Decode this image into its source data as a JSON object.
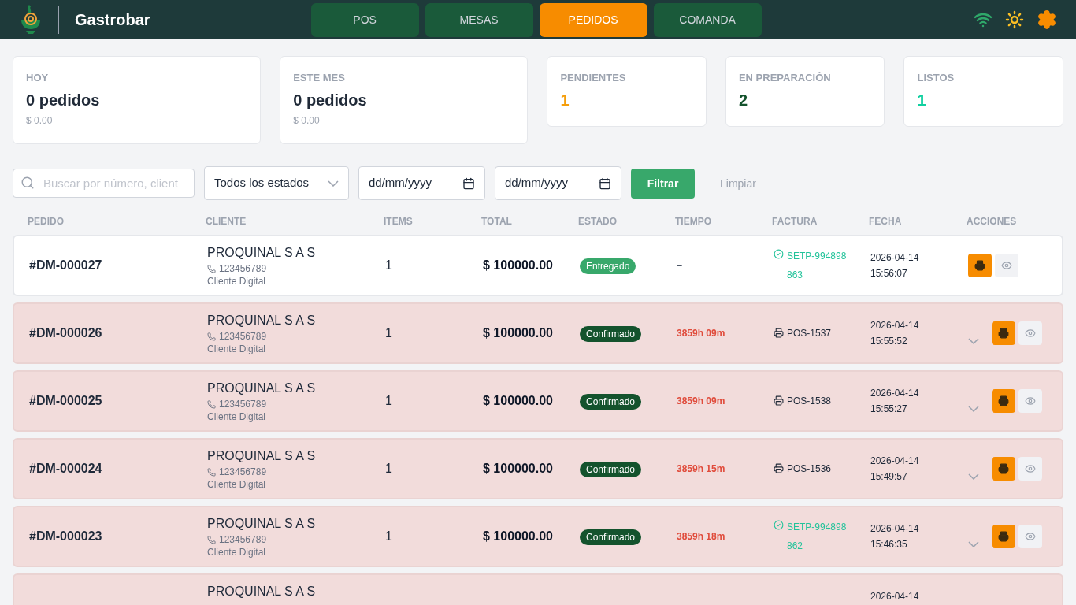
{
  "app": {
    "title": "Gastrobar"
  },
  "nav": [
    {
      "label": "POS",
      "selected": false
    },
    {
      "label": "MESAS",
      "selected": false
    },
    {
      "label": "PEDIDOS",
      "selected": true
    },
    {
      "label": "COMANDA",
      "selected": false
    }
  ],
  "stats": [
    {
      "label": "HOY",
      "value": "0 pedidos",
      "sub": "$ 0.00",
      "kind": "wide",
      "color": "#1f2937"
    },
    {
      "label": "ESTE MES",
      "value": "0 pedidos",
      "sub": "$ 0.00",
      "kind": "wide",
      "color": "#1f2937"
    },
    {
      "label": "PENDIENTES",
      "value": "1",
      "kind": "narrow",
      "color": "#f59e0b"
    },
    {
      "label": "EN PREPARACIÓN",
      "value": "2",
      "kind": "narrow",
      "color": "#14532d"
    },
    {
      "label": "LISTOS",
      "value": "1",
      "kind": "narrow",
      "color": "#10d0a0"
    }
  ],
  "filters": {
    "search": {
      "placeholder": "Buscar por número, client"
    },
    "status": "Todos los estados",
    "date_from": "dd/mm/yyyy",
    "date_to": "dd/mm/yyyy",
    "apply": "Filtrar",
    "clear": "Limpiar"
  },
  "table": {
    "columns": [
      "PEDIDO",
      "CLIENTE",
      "ITEMS",
      "TOTAL",
      "ESTADO",
      "TIEMPO",
      "FACTURA",
      "FECHA",
      "ACCIONES"
    ],
    "rows": [
      {
        "order": "#DM-000027",
        "client": "PROQUINAL S A S",
        "phone": "123456789",
        "channel": "Cliente Digital",
        "items": "1",
        "total": "$ 100000.00",
        "status": {
          "label": "Entregado",
          "kind": "delivered"
        },
        "time": "–",
        "overdue": false,
        "invoice": {
          "kind": "einvoice",
          "text": "SETP-994898863"
        },
        "date": "2026-04-14",
        "hour": "15:56:07",
        "expandable": false
      },
      {
        "order": "#DM-000026",
        "client": "PROQUINAL S A S",
        "phone": "123456789",
        "channel": "Cliente Digital",
        "items": "1",
        "total": "$ 100000.00",
        "status": {
          "label": "Confirmado",
          "kind": "confirmed"
        },
        "time": "3859h 09m",
        "overdue": true,
        "invoice": {
          "kind": "pos",
          "text": "POS-1537"
        },
        "date": "2026-04-14",
        "hour": "15:55:52",
        "expandable": true
      },
      {
        "order": "#DM-000025",
        "client": "PROQUINAL S A S",
        "phone": "123456789",
        "channel": "Cliente Digital",
        "items": "1",
        "total": "$ 100000.00",
        "status": {
          "label": "Confirmado",
          "kind": "confirmed"
        },
        "time": "3859h 09m",
        "overdue": true,
        "invoice": {
          "kind": "pos",
          "text": "POS-1538"
        },
        "date": "2026-04-14",
        "hour": "15:55:27",
        "expandable": true
      },
      {
        "order": "#DM-000024",
        "client": "PROQUINAL S A S",
        "phone": "123456789",
        "channel": "Cliente Digital",
        "items": "1",
        "total": "$ 100000.00",
        "status": {
          "label": "Confirmado",
          "kind": "confirmed"
        },
        "time": "3859h 15m",
        "overdue": true,
        "invoice": {
          "kind": "pos",
          "text": "POS-1536"
        },
        "date": "2026-04-14",
        "hour": "15:49:57",
        "expandable": true
      },
      {
        "order": "#DM-000023",
        "client": "PROQUINAL S A S",
        "phone": "123456789",
        "channel": "Cliente Digital",
        "items": "1",
        "total": "$ 100000.00",
        "status": {
          "label": "Confirmado",
          "kind": "confirmed"
        },
        "time": "3859h 18m",
        "overdue": true,
        "invoice": {
          "kind": "einvoice",
          "text": "SETP-994898862"
        },
        "date": "2026-04-14",
        "hour": "15:46:35",
        "expandable": true
      },
      {
        "client": "PROQUINAL S A S",
        "overdue": true,
        "date": "2026-04-14"
      }
    ]
  }
}
